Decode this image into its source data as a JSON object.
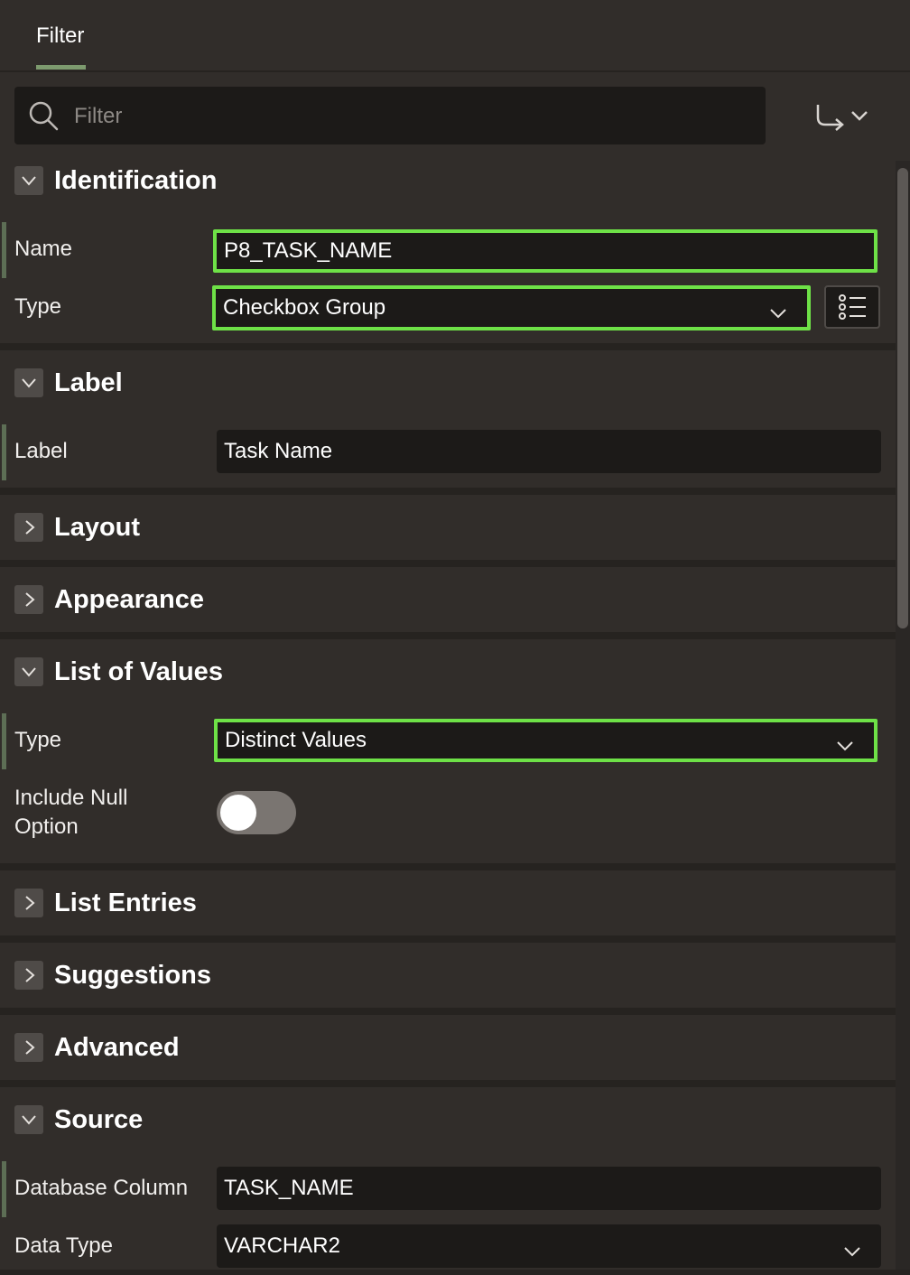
{
  "tabs": [
    {
      "label": "Filter"
    }
  ],
  "filter": {
    "placeholder": "Filter"
  },
  "sections": {
    "identification": {
      "title": "Identification",
      "name_label": "Name",
      "name_value": "P8_TASK_NAME",
      "type_label": "Type",
      "type_value": "Checkbox Group"
    },
    "label": {
      "title": "Label",
      "label_label": "Label",
      "label_value": "Task Name"
    },
    "layout": {
      "title": "Layout"
    },
    "appearance": {
      "title": "Appearance"
    },
    "lov": {
      "title": "List of Values",
      "type_label": "Type",
      "type_value": "Distinct Values",
      "null_label_line1": "Include Null",
      "null_label_line2": "Option",
      "null_option_on": false
    },
    "list_entries": {
      "title": "List Entries"
    },
    "suggestions": {
      "title": "Suggestions"
    },
    "advanced": {
      "title": "Advanced"
    },
    "source": {
      "title": "Source",
      "db_column_label": "Database Column",
      "db_column_value": "TASK_NAME",
      "data_type_label": "Data Type",
      "data_type_value": "VARCHAR2"
    }
  },
  "colors": {
    "background": "#312d2a",
    "field": "#1c1a18",
    "highlight": "#6ee147",
    "accent": "#7d9a6e"
  },
  "icons": [
    "search-icon",
    "goto-arrow-icon",
    "chevron-down-icon",
    "chevron-right-icon",
    "list-icon"
  ]
}
